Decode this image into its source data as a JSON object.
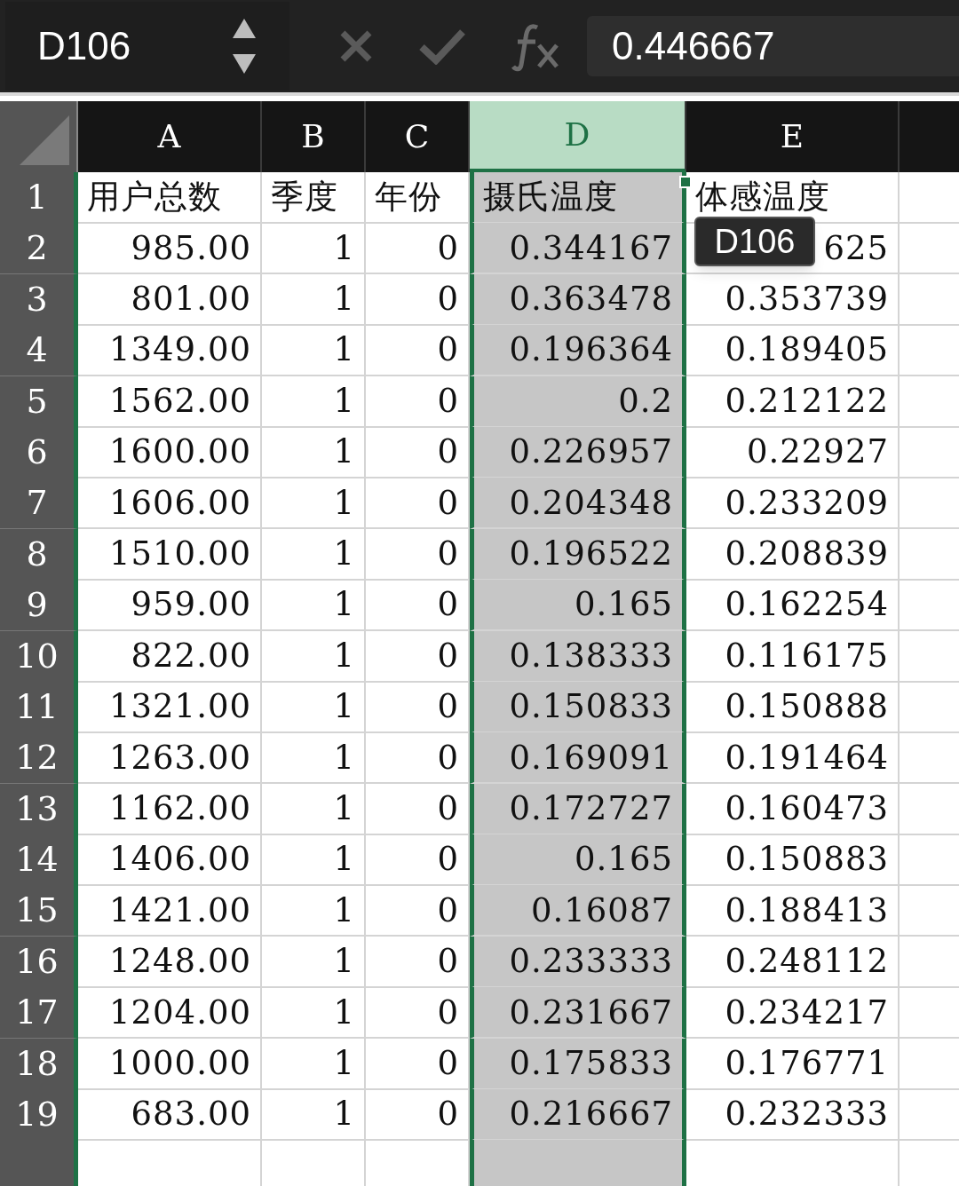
{
  "name_box": "D106",
  "formula_bar": {
    "value": "0.446667"
  },
  "columns": [
    {
      "label": "A",
      "selected": false
    },
    {
      "label": "B",
      "selected": false
    },
    {
      "label": "C",
      "selected": false
    },
    {
      "label": "D",
      "selected": true
    },
    {
      "label": "E",
      "selected": false
    }
  ],
  "rows": [
    {
      "number": "1",
      "cells": [
        "用户总数",
        "季度",
        "年份",
        "摄氏温度",
        "体感温度"
      ]
    },
    {
      "number": "2",
      "cells": [
        "985.00",
        "1",
        "0",
        "0.344167",
        "625"
      ]
    },
    {
      "number": "3",
      "cells": [
        "801.00",
        "1",
        "0",
        "0.363478",
        "0.353739"
      ]
    },
    {
      "number": "4",
      "cells": [
        "1349.00",
        "1",
        "0",
        "0.196364",
        "0.189405"
      ]
    },
    {
      "number": "5",
      "cells": [
        "1562.00",
        "1",
        "0",
        "0.2",
        "0.212122"
      ]
    },
    {
      "number": "6",
      "cells": [
        "1600.00",
        "1",
        "0",
        "0.226957",
        "0.22927"
      ]
    },
    {
      "number": "7",
      "cells": [
        "1606.00",
        "1",
        "0",
        "0.204348",
        "0.233209"
      ]
    },
    {
      "number": "8",
      "cells": [
        "1510.00",
        "1",
        "0",
        "0.196522",
        "0.208839"
      ]
    },
    {
      "number": "9",
      "cells": [
        "959.00",
        "1",
        "0",
        "0.165",
        "0.162254"
      ]
    },
    {
      "number": "10",
      "cells": [
        "822.00",
        "1",
        "0",
        "0.138333",
        "0.116175"
      ]
    },
    {
      "number": "11",
      "cells": [
        "1321.00",
        "1",
        "0",
        "0.150833",
        "0.150888"
      ]
    },
    {
      "number": "12",
      "cells": [
        "1263.00",
        "1",
        "0",
        "0.169091",
        "0.191464"
      ]
    },
    {
      "number": "13",
      "cells": [
        "1162.00",
        "1",
        "0",
        "0.172727",
        "0.160473"
      ]
    },
    {
      "number": "14",
      "cells": [
        "1406.00",
        "1",
        "0",
        "0.165",
        "0.150883"
      ]
    },
    {
      "number": "15",
      "cells": [
        "1421.00",
        "1",
        "0",
        "0.16087",
        "0.188413"
      ]
    },
    {
      "number": "16",
      "cells": [
        "1248.00",
        "1",
        "0",
        "0.233333",
        "0.248112"
      ]
    },
    {
      "number": "17",
      "cells": [
        "1204.00",
        "1",
        "0",
        "0.231667",
        "0.234217"
      ]
    },
    {
      "number": "18",
      "cells": [
        "1000.00",
        "1",
        "0",
        "0.175833",
        "0.176771"
      ]
    },
    {
      "number": "19",
      "cells": [
        "683.00",
        "1",
        "0",
        "0.216667",
        "0.232333"
      ]
    }
  ],
  "tooltip": "D106"
}
